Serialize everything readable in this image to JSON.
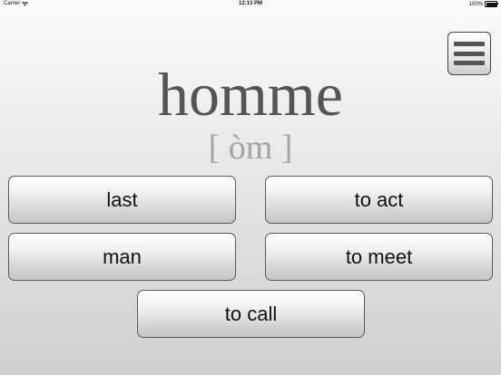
{
  "status_bar": {
    "carrier": "Carrier",
    "time": "12:13 PM",
    "battery": "100%"
  },
  "icons": {
    "wifi": "wifi-icon",
    "battery": "battery-icon",
    "menu": "hamburger-menu-icon"
  },
  "quiz": {
    "word": "homme",
    "pronunciation": "[ òm ]",
    "answers": [
      "last",
      "to act",
      "man",
      "to meet",
      "to call"
    ]
  }
}
